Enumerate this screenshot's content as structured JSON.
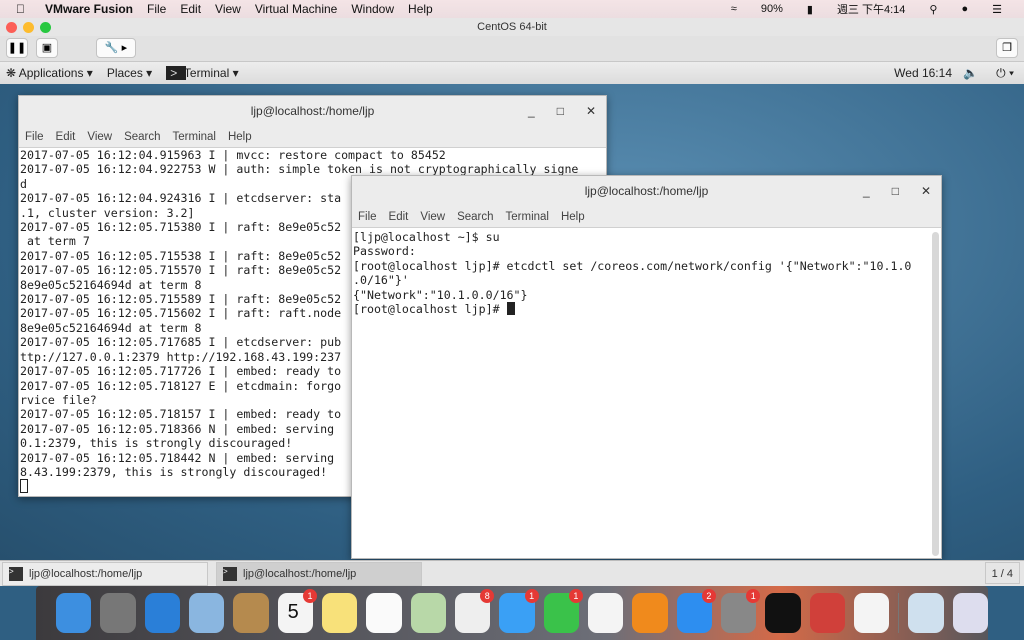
{
  "mac_menu": {
    "app": "VMware Fusion",
    "items": [
      "File",
      "Edit",
      "View",
      "Virtual Machine",
      "Window",
      "Help"
    ],
    "battery": "90%",
    "clock": "週三 下午4:14"
  },
  "vm_window": {
    "title": "CentOS 64-bit"
  },
  "gnome_bar": {
    "applications": "Applications",
    "places": "Places",
    "terminal": "Terminal",
    "clock": "Wed 16:14"
  },
  "term_back": {
    "title": "ljp@localhost:/home/ljp",
    "menu": [
      "File",
      "Edit",
      "View",
      "Search",
      "Terminal",
      "Help"
    ],
    "lines": [
      "2017-07-05 16:12:04.915963 I | mvcc: restore compact to 85452",
      "2017-07-05 16:12:04.922753 W | auth: simple token is not cryptographically signe",
      "d",
      "2017-07-05 16:12:04.924316 I | etcdserver: sta",
      ".1, cluster version: 3.2]",
      "2017-07-05 16:12:05.715380 I | raft: 8e9e05c52",
      " at term 7",
      "2017-07-05 16:12:05.715538 I | raft: 8e9e05c52",
      "2017-07-05 16:12:05.715570 I | raft: 8e9e05c52",
      "8e9e05c52164694d at term 8",
      "2017-07-05 16:12:05.715589 I | raft: 8e9e05c52",
      "2017-07-05 16:12:05.715602 I | raft: raft.node",
      "8e9e05c52164694d at term 8",
      "2017-07-05 16:12:05.717685 I | etcdserver: pub",
      "ttp://127.0.0.1:2379 http://192.168.43.199:237",
      "2017-07-05 16:12:05.717726 I | embed: ready to",
      "2017-07-05 16:12:05.718127 E | etcdmain: forgo",
      "rvice file?",
      "2017-07-05 16:12:05.718157 I | embed: ready to",
      "2017-07-05 16:12:05.718366 N | embed: serving",
      "0.1:2379, this is strongly discouraged!",
      "2017-07-05 16:12:05.718442 N | embed: serving",
      "8.43.199:2379, this is strongly discouraged!"
    ]
  },
  "term_front": {
    "title": "ljp@localhost:/home/ljp",
    "menu": [
      "File",
      "Edit",
      "View",
      "Search",
      "Terminal",
      "Help"
    ],
    "lines": [
      "[ljp@localhost ~]$ su",
      "Password:",
      "[root@localhost ljp]# etcdctl set /coreos.com/network/config '{\"Network\":\"10.1.0",
      ".0/16\"}'",
      "{\"Network\":\"10.1.0.0/16\"}"
    ],
    "prompt": "[root@localhost ljp]# "
  },
  "taskbar": {
    "tasks": [
      "ljp@localhost:/home/ljp",
      "ljp@localhost:/home/ljp"
    ],
    "workspace": "1 / 4"
  },
  "dock": [
    {
      "name": "finder",
      "color": "#3d8fe0"
    },
    {
      "name": "launchpad",
      "color": "#777"
    },
    {
      "name": "safari",
      "color": "#2a7fd8"
    },
    {
      "name": "mail",
      "color": "#8ab6e0"
    },
    {
      "name": "contacts",
      "color": "#b58a4e"
    },
    {
      "name": "calendar",
      "color": "#f4f4f4",
      "text": "5",
      "badge": "1"
    },
    {
      "name": "notes",
      "color": "#f8e17a"
    },
    {
      "name": "reminders",
      "color": "#fafafa"
    },
    {
      "name": "maps",
      "color": "#b8d8a8"
    },
    {
      "name": "photos",
      "color": "#eee",
      "badge": "8"
    },
    {
      "name": "messages",
      "color": "#3aa0f5",
      "badge": "1"
    },
    {
      "name": "facetime",
      "color": "#3ac24a",
      "badge": "1"
    },
    {
      "name": "itunes",
      "color": "#f4f4f4"
    },
    {
      "name": "ibooks",
      "color": "#f08a1c"
    },
    {
      "name": "app-store",
      "color": "#2d8ef0",
      "badge": "2"
    },
    {
      "name": "system-preferences",
      "color": "#888",
      "badge": "1"
    },
    {
      "name": "terminal",
      "color": "#111"
    },
    {
      "name": "vmware-fusion",
      "color": "#d0403a"
    },
    {
      "name": "textedit",
      "color": "#f4f4f4"
    },
    {
      "name": "downloads",
      "color": "#cfe0ee"
    },
    {
      "name": "trash",
      "color": "#dde"
    }
  ]
}
